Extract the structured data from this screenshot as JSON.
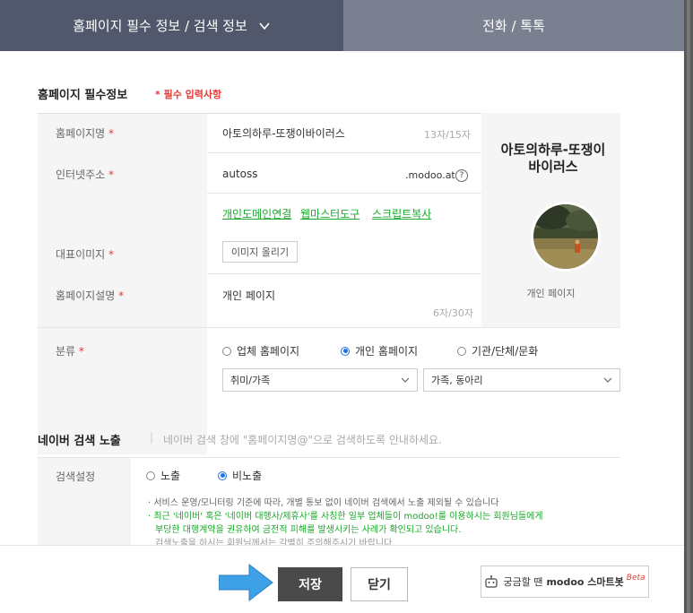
{
  "tabs": [
    {
      "label": "홈페이지 필수 정보 / 검색 정보"
    },
    {
      "label": "전화 / 톡톡"
    }
  ],
  "required_section": {
    "title": "홈페이지 필수정보",
    "note": "* 필수 입력사항"
  },
  "fields": {
    "name": {
      "label": "홈페이지명",
      "value": "아토의하루-또쟁이바이러스",
      "counter": "13자/15자"
    },
    "address": {
      "label": "인터넷주소",
      "value": "autoss",
      "domain": ".modoo.at",
      "help": "?"
    },
    "links": [
      "개인도메인연결",
      "웹마스터도구",
      "스크립트복사"
    ],
    "image": {
      "label": "대표이미지",
      "button": "이미지 올리기"
    },
    "description": {
      "label": "홈페이지설명",
      "value": "개인 페이지",
      "counter": "6자/30자"
    },
    "category": {
      "label": "분류",
      "options": [
        "업체 홈페이지",
        "개인 홈페이지",
        "기관/단체/문화"
      ],
      "selected_index": 1,
      "select1": "취미/가족",
      "select2": "가족, 동아리"
    },
    "required_mark": "*"
  },
  "preview": {
    "title": "아토의하루-또쟁이바이러스",
    "subtitle": "개인 페이지"
  },
  "naver": {
    "title": "네이버 검색 노출",
    "separator": "|",
    "desc": "네이버 검색 창에 \"홈페이지명@\"으로 검색하도록 안내하세요.",
    "setting_label": "검색설정",
    "options": [
      "노출",
      "비노출"
    ],
    "selected_index": 1,
    "notes": [
      "· 서비스 운영/모니터링 기준에 따라, 개별 통보 없이 네이버 검색에서 노출 제외될 수 있습니다",
      "· 최근 '네이버' 혹은 '네이버 대행사/제휴사'를 사칭한 일부 업체들이 modoo!를 이용하시는 회원님들에게",
      "  부당한 대행계약을 권유하여 금전적 피해를 발생시키는 사례가 확인되고 있습니다.",
      "  검색노출을 하시는 회원님께서는 각별히 주의해주시기 바랍니다."
    ]
  },
  "footer": {
    "save": "저장",
    "close": "닫기",
    "smartbot_prefix": "궁금할 땐",
    "smartbot_brand": "modoo 스마트봇",
    "smartbot_beta": "Beta"
  },
  "colors": {
    "tab_active": "#51586b",
    "tab_inactive": "#7a808f",
    "required_red": "#e53935",
    "link_green": "#1aa82a",
    "radio_blue": "#1a73e8",
    "save_dark": "#4a4a4a",
    "pointer_blue": "#3ea0e6"
  }
}
